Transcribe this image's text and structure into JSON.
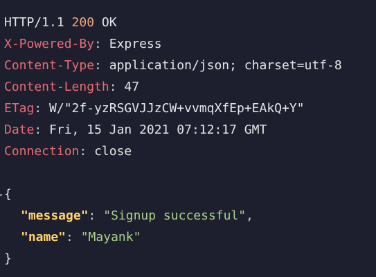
{
  "status_line": {
    "protocol": "HTTP/1.1",
    "code": "200",
    "reason": "OK"
  },
  "headers": [
    {
      "key": "X-Powered-By",
      "value": "Express"
    },
    {
      "key": "Content-Type",
      "value": "application/json; charset=utf-8"
    },
    {
      "key": "Content-Length",
      "value": "47"
    },
    {
      "key": "ETag",
      "value": "W/\"2f-yzRSGVJJzCW+vvmqXfEp+EAkQ+Y\""
    },
    {
      "key": "Date",
      "value": "Fri, 15 Jan 2021 07:12:17 GMT"
    },
    {
      "key": "Connection",
      "value": "close"
    }
  ],
  "body": {
    "open_brace": "{",
    "close_brace": "}",
    "fields": [
      {
        "key": "\"message\"",
        "value": "\"Signup successful\"",
        "trailing": ","
      },
      {
        "key": "\"name\"",
        "value": "\"Mayank\"",
        "trailing": ""
      }
    ]
  },
  "colors": {
    "background": "#1e1f2e",
    "header_key": "#e86c73",
    "status_code": "#f0a87a",
    "json_key": "#ffd36e",
    "json_string": "#a8d48a"
  }
}
